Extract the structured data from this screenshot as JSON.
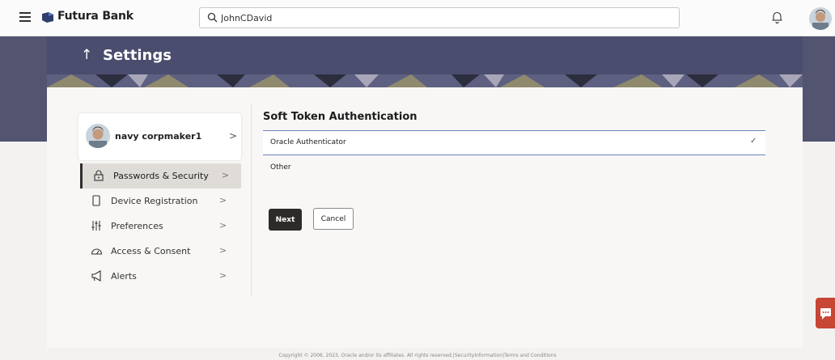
{
  "header": {
    "brand_name": "Futura Bank",
    "search_value": "JohnCDavid"
  },
  "page": {
    "title": "Settings",
    "back_arrow": "↑"
  },
  "profile": {
    "name": "navy corpmaker1",
    "chevron": ">"
  },
  "menu": [
    {
      "label": "Passwords & Security",
      "icon": "lock-icon",
      "active": true
    },
    {
      "label": "Device Registration",
      "icon": "mobile-device-icon",
      "active": false
    },
    {
      "label": "Preferences",
      "icon": "sliders-icon",
      "active": false
    },
    {
      "label": "Access & Consent",
      "icon": "gauge-icon",
      "active": false
    },
    {
      "label": "Alerts",
      "icon": "megaphone-icon",
      "active": false
    }
  ],
  "menu_chevron": ">",
  "content": {
    "section_title": "Soft Token Authentication",
    "options": [
      {
        "label": "Oracle Authenticator",
        "selected": true,
        "check": "✓"
      },
      {
        "label": "Other",
        "selected": false
      }
    ],
    "next_label": "Next",
    "cancel_label": "Cancel"
  },
  "footer": {
    "text": "Copyright © 2006, 2023, Oracle and/or its affiliates. All rights reserved.|SecurityInformation|Terms and Conditions"
  },
  "colors": {
    "header_band": "#4a4d6d",
    "primary_button": "#2d2b29",
    "selected_border": "#6d7fbf",
    "chat_button": "#c74634"
  }
}
